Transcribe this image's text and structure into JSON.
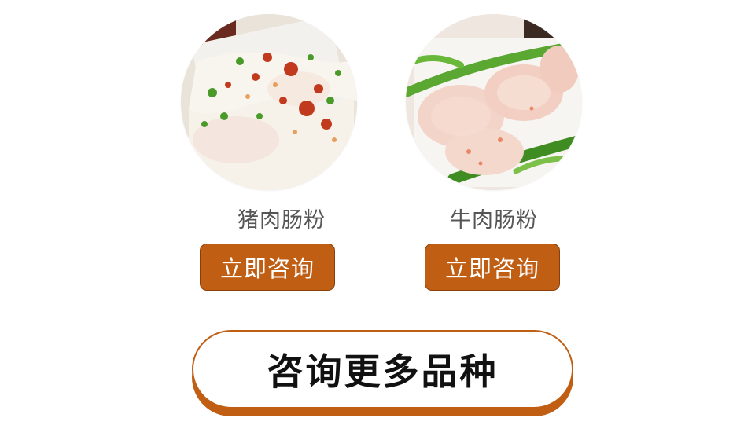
{
  "products": [
    {
      "name": "猪肉肠粉",
      "button_label": "立即咨询",
      "image_icon": "pork-rice-roll-photo"
    },
    {
      "name": "牛肉肠粉",
      "button_label": "立即咨询",
      "image_icon": "beef-rice-roll-photo"
    }
  ],
  "more_button": {
    "label": "咨询更多品种"
  },
  "colors": {
    "accent": "#c05e14",
    "accent_border": "#8a3f0a",
    "name_text": "#555555",
    "more_text": "#111111"
  }
}
